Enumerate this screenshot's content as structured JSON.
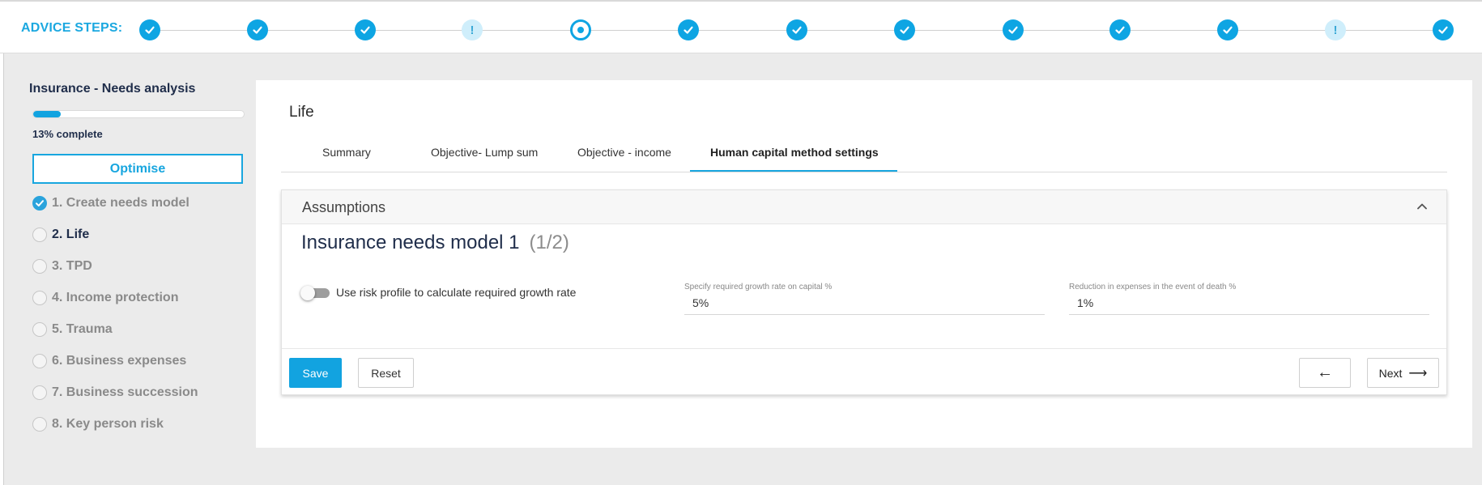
{
  "header": {
    "title": "ADVICE STEPS:",
    "steps": [
      {
        "status": "complete",
        "icon": "check-icon"
      },
      {
        "status": "complete",
        "icon": "check-icon"
      },
      {
        "status": "complete",
        "icon": "check-icon"
      },
      {
        "status": "warning",
        "icon": "exclamation-icon",
        "symbol": "!"
      },
      {
        "status": "current",
        "icon": "current-dot-icon"
      },
      {
        "status": "complete",
        "icon": "check-icon"
      },
      {
        "status": "complete",
        "icon": "check-icon"
      },
      {
        "status": "complete",
        "icon": "check-icon"
      },
      {
        "status": "complete",
        "icon": "check-icon"
      },
      {
        "status": "complete",
        "icon": "check-icon"
      },
      {
        "status": "complete",
        "icon": "check-icon"
      },
      {
        "status": "warning",
        "icon": "exclamation-icon",
        "symbol": "!"
      },
      {
        "status": "complete",
        "icon": "check-icon"
      }
    ]
  },
  "sidebar": {
    "title": "Insurance - Needs analysis",
    "progress_fraction": 0.13,
    "progress_text": "13% complete",
    "optimise_label": "Optimise",
    "items": [
      {
        "label": "1. Create needs model",
        "state": "checked"
      },
      {
        "label": "2. Life",
        "state": "active"
      },
      {
        "label": "3. TPD",
        "state": "unchecked"
      },
      {
        "label": "4. Income protection",
        "state": "unchecked"
      },
      {
        "label": "5. Trauma",
        "state": "unchecked"
      },
      {
        "label": "6. Business expenses",
        "state": "unchecked"
      },
      {
        "label": "7. Business succession",
        "state": "unchecked"
      },
      {
        "label": "8. Key person risk",
        "state": "unchecked"
      }
    ]
  },
  "content": {
    "section_title": "Life",
    "tabs": [
      {
        "label": "Summary",
        "active": false
      },
      {
        "label": "Objective- Lump sum",
        "active": false
      },
      {
        "label": "Objective - income",
        "active": false
      },
      {
        "label": "Human capital method settings",
        "active": true
      }
    ],
    "panel": {
      "title": "Assumptions",
      "model_title": "Insurance needs model 1",
      "model_count": "(1/2)",
      "toggle_label": "Use risk profile to calculate required growth rate",
      "toggle_on": false,
      "fields": [
        {
          "label": "Specify required growth rate on capital %",
          "value": "5%"
        },
        {
          "label": "Reduction in expenses in the event of death %",
          "value": "1%"
        }
      ]
    },
    "buttons": {
      "save": "Save",
      "reset": "Reset",
      "back_symbol": "←",
      "next": "Next",
      "next_symbol": "⟶"
    }
  },
  "colors": {
    "accent": "#12a3e0",
    "warning_bg": "#cfeefb",
    "page_bg": "#ebebeb",
    "text_dark": "#1f2d4a"
  }
}
